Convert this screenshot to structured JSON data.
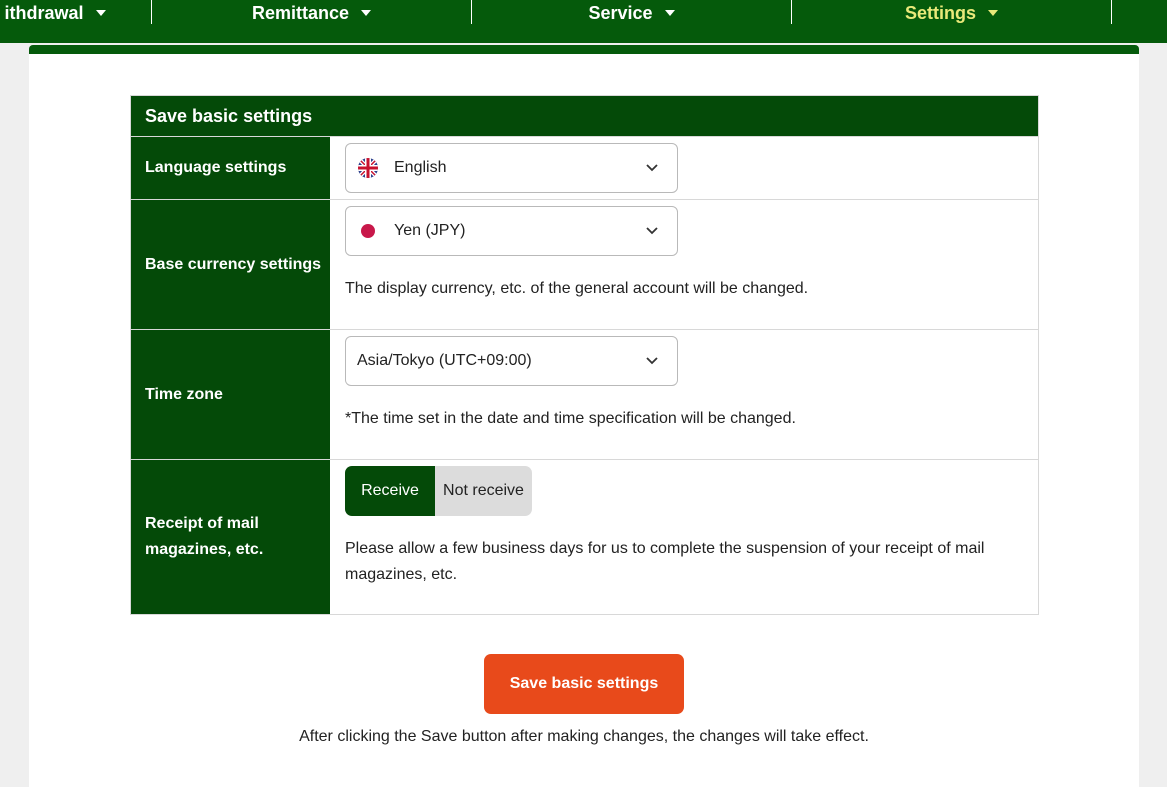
{
  "nav": {
    "items": [
      {
        "label": "ithdrawal"
      },
      {
        "label": "Remittance"
      },
      {
        "label": "Service"
      },
      {
        "label": "Settings"
      }
    ]
  },
  "settings": {
    "header": "Save basic settings",
    "language": {
      "label": "Language settings",
      "value": "English",
      "flag_icon": "uk-flag-icon"
    },
    "currency": {
      "label": "Base currency settings",
      "value": "Yen (JPY)",
      "flag_icon": "japan-flag-icon",
      "note": "The display currency, etc. of the general account will be changed."
    },
    "timezone": {
      "label": "Time zone",
      "value": "Asia/Tokyo (UTC+09:00)",
      "note": "*The time set in the date and time specification will be changed."
    },
    "mail": {
      "label": "Receipt of mail magazines, etc.",
      "option_on": "Receive",
      "option_off": "Not receive",
      "selected": "Receive",
      "note": "Please allow a few business days for us to complete the suspension of your receipt of mail magazines, etc."
    }
  },
  "save": {
    "button_label": "Save basic settings",
    "note": "After clicking the Save button after making changes, the changes will take effect."
  },
  "colors": {
    "nav_bg": "#055a0b",
    "label_bg": "#044a08",
    "active_nav": "#e9e97a",
    "save_button": "#e84a1b",
    "toggle_off": "#dcdcdc"
  }
}
